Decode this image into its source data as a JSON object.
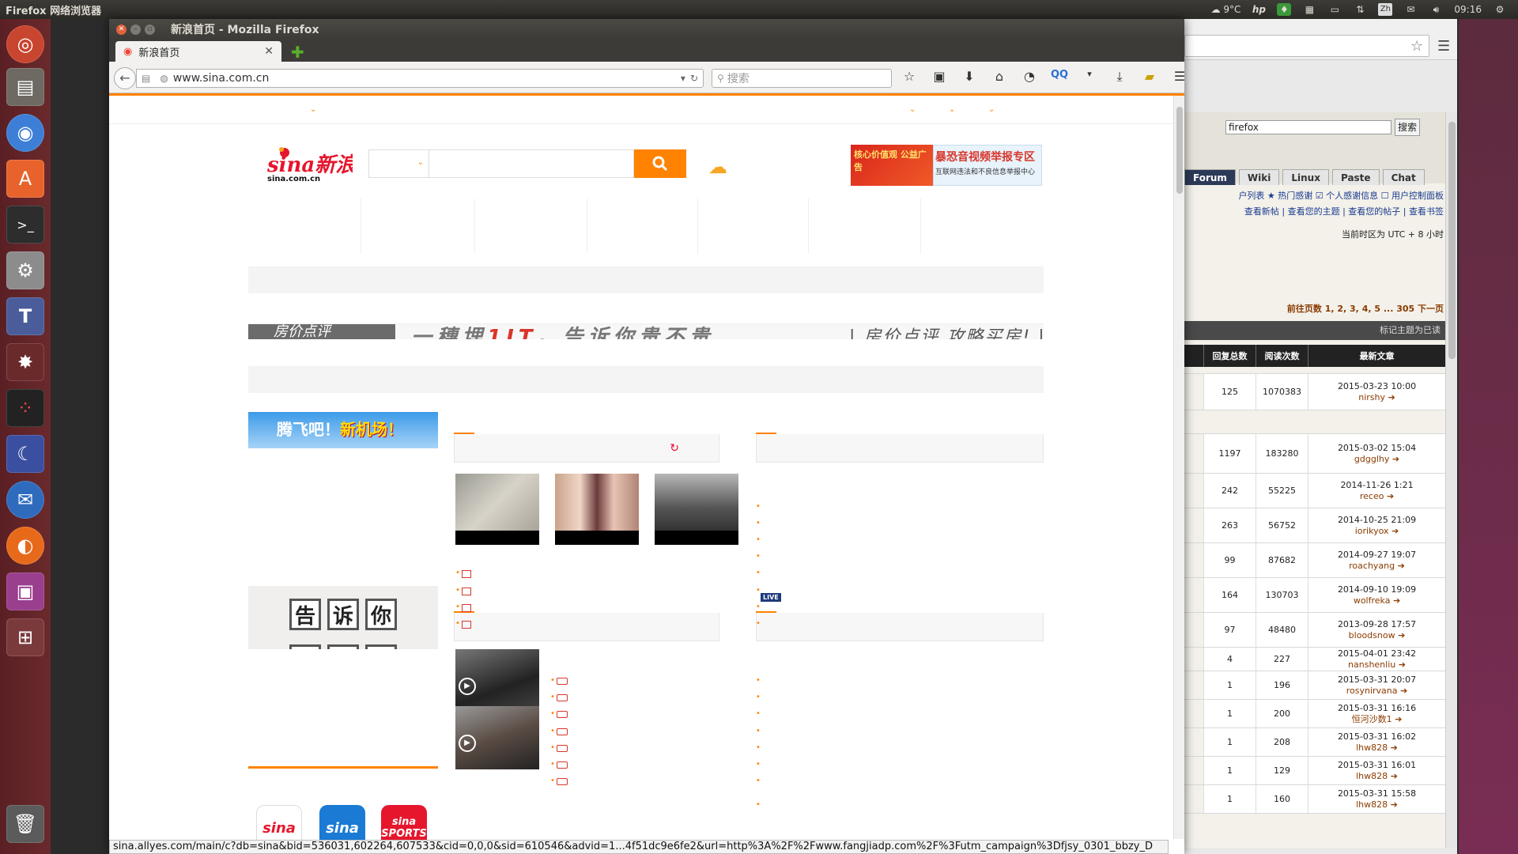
{
  "panel": {
    "app_title": "Firefox 网络浏览器",
    "weather": "9°C",
    "input_method": "Zh",
    "clock": "09:16"
  },
  "window": {
    "title": "新浪首页 - Mozilla Firefox"
  },
  "tab": {
    "title": "新浪首页"
  },
  "navbar": {
    "url": "www.sina.com.cn",
    "search_placeholder": "搜索"
  },
  "sina": {
    "logo_text": "sina新浪网",
    "logo_domain": "sina.com.cn",
    "ad_top_left": "核心价值观 公益广告",
    "ad_top_title": "暴恐音视频举报专区",
    "ad_top_sub": "互联网违法和不良信息举报中心",
    "banner_left": "房价点评",
    "banner_mid_a": "一穗埋",
    "banner_mid_red": "1IT",
    "banner_mid_b": "。告诉你贵不贵",
    "banner_right": "| 房价点评 攻略买房! |",
    "left_ad_white": "腾飞吧！",
    "left_ad_yellow": "新机场！",
    "tell_chars": [
      "告",
      "诉",
      "你"
    ],
    "live_label": "LIVE",
    "app_labels": [
      "sina",
      "sina",
      "sina SPORTS"
    ]
  },
  "back_window": {
    "search_value": "firefox",
    "search_button": "搜索",
    "tabs": [
      "Forum",
      "Wiki",
      "Linux",
      "Paste",
      "Chat"
    ],
    "links_line1": "户列表  ★ 热门感谢  ☑ 个人感谢信息  ☐ 用户控制面板",
    "links_line2": "查看新帖 | 查看您的主题 | 查看您的帖子 | 查看书签",
    "timezone": "当前时区为 UTC + 8 小时",
    "pagination": "前往页数 1, 2, 3, 4, 5 ... 305  下一页",
    "mark_read": "标记主题为已读",
    "columns": [
      "回复总数",
      "阅读次数",
      "最新文章"
    ],
    "rows": [
      {
        "replies": "125",
        "views": "1070383",
        "date": "2015-03-23 10:00",
        "author": "nirshy"
      },
      {
        "replies": "1197",
        "views": "183280",
        "date": "2015-03-02 15:04",
        "author": "gdgglhy"
      },
      {
        "replies": "242",
        "views": "55225",
        "date": "2014-11-26 1:21",
        "author": "receo"
      },
      {
        "replies": "263",
        "views": "56752",
        "date": "2014-10-25 21:09",
        "author": "iorikyox"
      },
      {
        "replies": "99",
        "views": "87682",
        "date": "2014-09-27 19:07",
        "author": "roachyang"
      },
      {
        "replies": "164",
        "views": "130703",
        "date": "2014-09-10 19:09",
        "author": "wolfreka"
      },
      {
        "replies": "97",
        "views": "48480",
        "date": "2013-09-28 17:57",
        "author": "bloodsnow"
      },
      {
        "replies": "4",
        "views": "227",
        "date": "2015-04-01 23:42",
        "author": "nanshenliu"
      },
      {
        "replies": "1",
        "views": "196",
        "date": "2015-03-31 20:07",
        "author": "rosynirvana"
      },
      {
        "replies": "1",
        "views": "200",
        "date": "2015-03-31 16:16",
        "author": "恒河沙数1"
      },
      {
        "replies": "1",
        "views": "208",
        "date": "2015-03-31 16:02",
        "author": "lhw828"
      },
      {
        "replies": "1",
        "views": "129",
        "date": "2015-03-31 16:01",
        "author": "lhw828"
      },
      {
        "replies": "1",
        "views": "160",
        "date": "2015-03-31 15:58",
        "author": "lhw828"
      }
    ]
  },
  "status": {
    "link": "sina.allyes.com/main/c?db=sina&bid=536031,602264,607533&cid=0,0,0&sid=610546&advid=1...4f51dc9e6fe2&url=http%3A%2F%2Fwww.fangjiadp.com%2F%3Futm_campaign%3Dfjsy_0301_bbzy_D"
  },
  "colors": {
    "sina_orange": "#ff8200",
    "ubuntu_panel": "#3c3b37",
    "launcher": "#5a1f24"
  }
}
